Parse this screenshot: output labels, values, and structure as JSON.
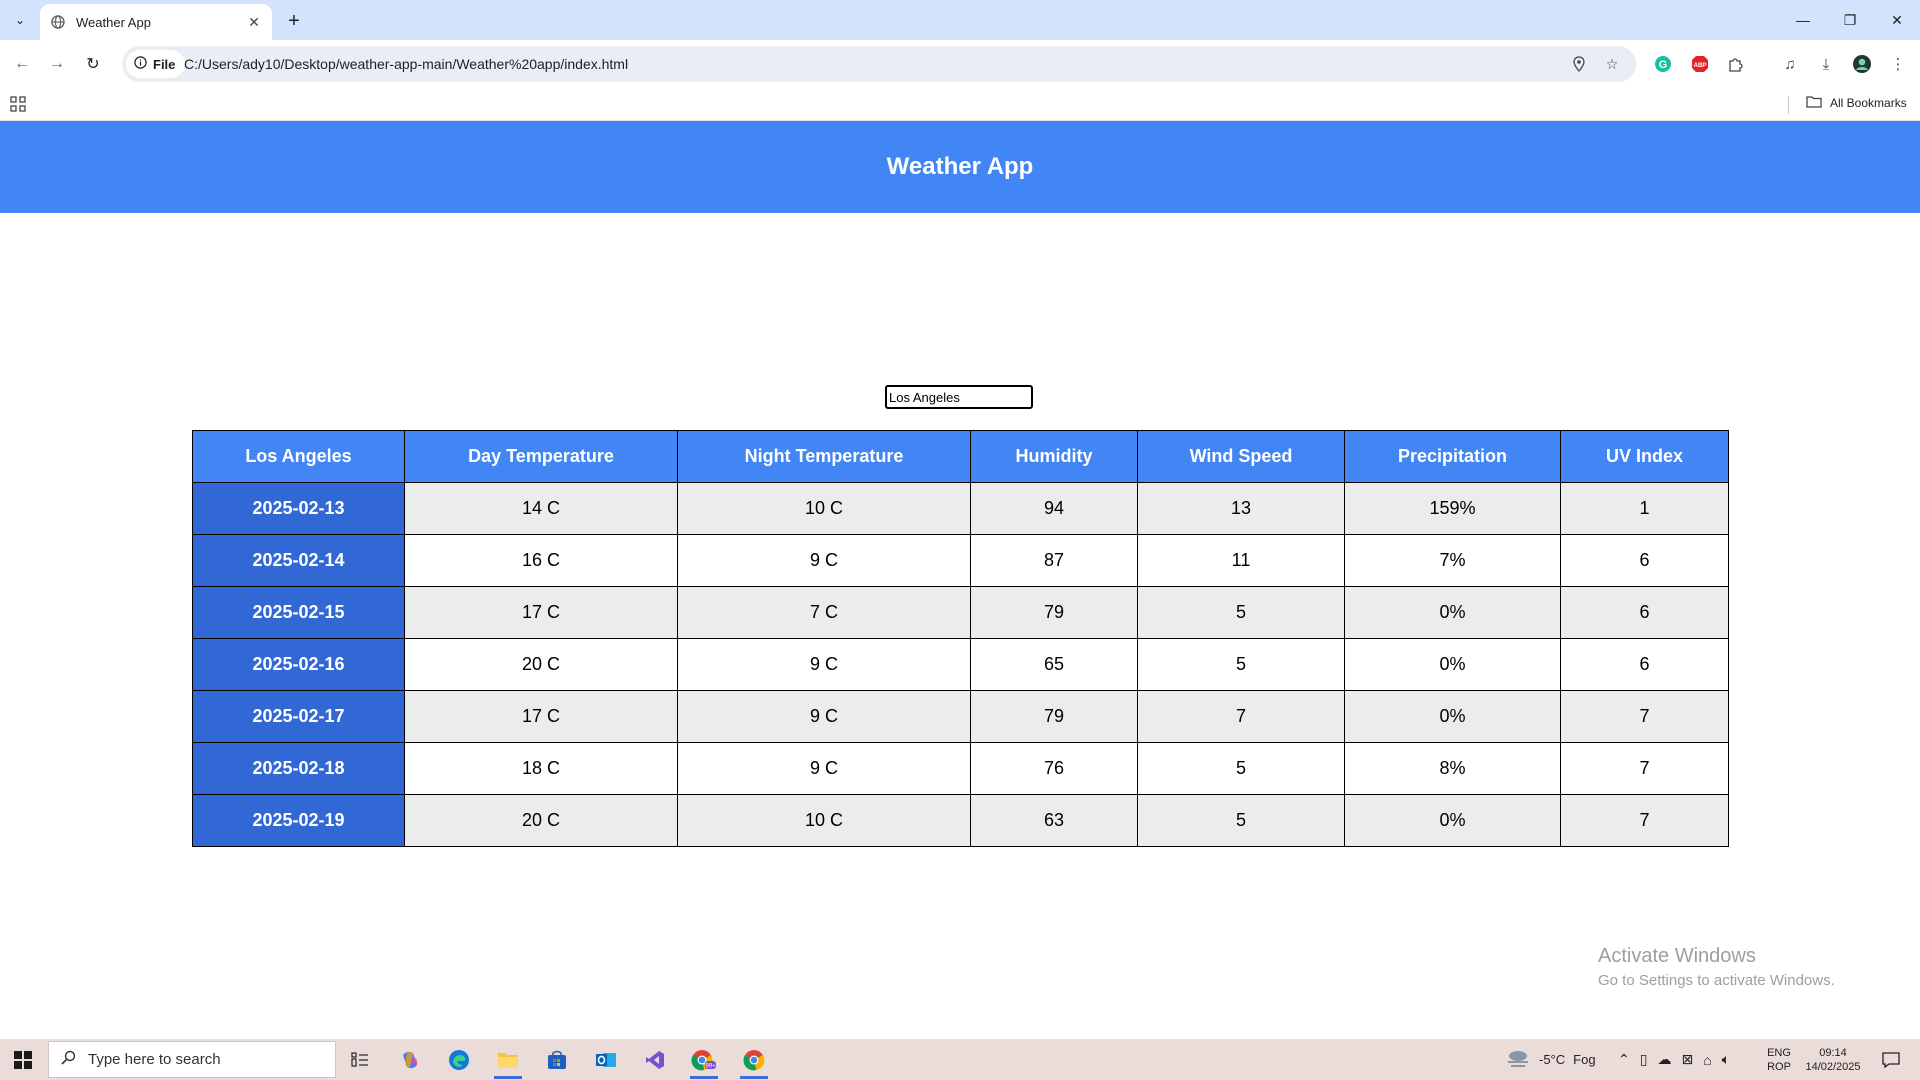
{
  "browser": {
    "tab_title": "Weather App",
    "new_tab_label": "+",
    "omnibox_scheme_label": "File",
    "url": "C:/Users/ady10/Desktop/weather-app-main/Weather%20app/index.html",
    "all_bookmarks_label": "All Bookmarks"
  },
  "app": {
    "title": "Weather App",
    "city_input_value": "Los Angeles"
  },
  "table": {
    "headers": [
      "Los Angeles",
      "Day Temperature",
      "Night Temperature",
      "Humidity",
      "Wind Speed",
      "Precipitation",
      "UV Index"
    ],
    "rows": [
      {
        "date": "2025-02-13",
        "day": "14 C",
        "night": "10 C",
        "humidity": "94",
        "wind": "13",
        "precip": "159%",
        "uv": "1"
      },
      {
        "date": "2025-02-14",
        "day": "16 C",
        "night": "9 C",
        "humidity": "87",
        "wind": "11",
        "precip": "7%",
        "uv": "6"
      },
      {
        "date": "2025-02-15",
        "day": "17 C",
        "night": "7 C",
        "humidity": "79",
        "wind": "5",
        "precip": "0%",
        "uv": "6"
      },
      {
        "date": "2025-02-16",
        "day": "20 C",
        "night": "9 C",
        "humidity": "65",
        "wind": "5",
        "precip": "0%",
        "uv": "6"
      },
      {
        "date": "2025-02-17",
        "day": "17 C",
        "night": "9 C",
        "humidity": "79",
        "wind": "7",
        "precip": "0%",
        "uv": "7"
      },
      {
        "date": "2025-02-18",
        "day": "18 C",
        "night": "9 C",
        "humidity": "76",
        "wind": "5",
        "precip": "8%",
        "uv": "7"
      },
      {
        "date": "2025-02-19",
        "day": "20 C",
        "night": "10 C",
        "humidity": "63",
        "wind": "5",
        "precip": "0%",
        "uv": "7"
      }
    ]
  },
  "watermark": {
    "line1": "Activate Windows",
    "line2": "Go to Settings to activate Windows."
  },
  "taskbar": {
    "search_placeholder": "Type here to search",
    "weather_temp": "-5°C",
    "weather_desc": "Fog",
    "lang_line1": "ENG",
    "lang_line2": "ROP",
    "time": "09:14",
    "date": "14/02/2025",
    "badge_count": "99+"
  },
  "colors": {
    "header_blue": "#4285f4",
    "date_cell_blue": "#3267d6",
    "taskbar_bg": "#eadcd8",
    "tabbar_bg": "#d3e3fd"
  }
}
